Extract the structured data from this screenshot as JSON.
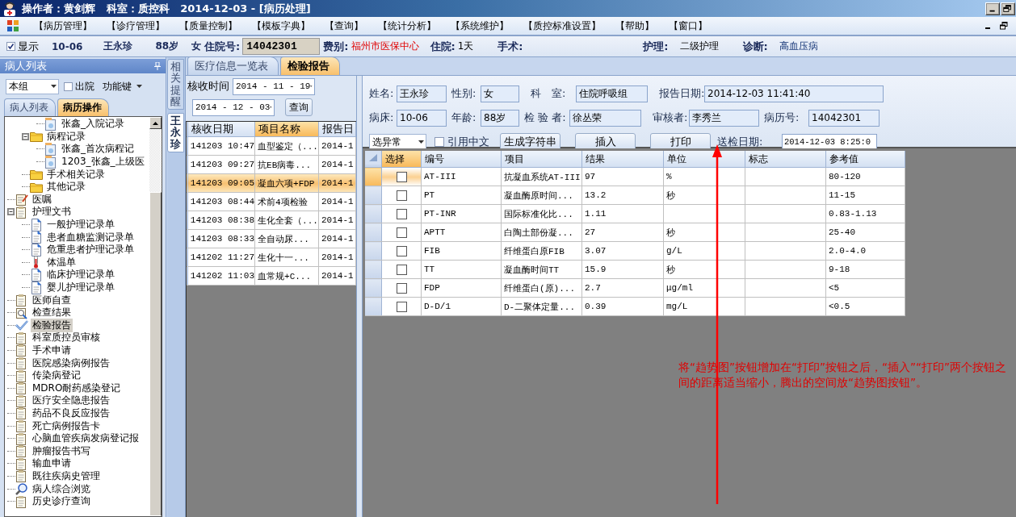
{
  "window": {
    "title": "操作者：黄剑辉   科室：质控科   2014-12-03 - [病历处理]"
  },
  "menu": [
    "【病历管理】",
    "【诊疗管理】",
    "【质量控制】",
    "【模板字典】",
    "【查询】",
    "【统计分析】",
    "【系统维护】",
    "【质控标准设置】",
    "【帮助】",
    "【窗口】"
  ],
  "patient_bar": {
    "show": {
      "label": "显示",
      "checked": true
    },
    "bed": "10-06",
    "name": "王永珍",
    "age": "88岁",
    "sex": "女",
    "fields": [
      {
        "label": "住院号:",
        "value": "14042301",
        "kind": "box"
      },
      {
        "label": "费别:",
        "value": "福州市医保中心",
        "kind": "alert"
      },
      {
        "label": "住院:",
        "value": "1天",
        "kind": "plain"
      },
      {
        "label": "手术:"
      },
      {
        "label": "护理:",
        "value": "二级护理",
        "kind": "plain"
      },
      {
        "label": "诊断:",
        "value": "高血压病",
        "kind": "info"
      }
    ]
  },
  "patient_panel": {
    "title": "病人列表",
    "group_select": "本组",
    "discharged": {
      "label": "出院",
      "checked": false
    },
    "function_menu": "功能键",
    "tabs": [
      {
        "label": "病人列表",
        "selected": false
      },
      {
        "label": "病历操作",
        "selected": true
      }
    ],
    "tree": [
      {
        "children": [
          {
            "children": [
              {
                "label": "张鑫_入院记录",
                "kind": "record",
                "selected": false
              }
            ]
          },
          {
            "label": "病程记录",
            "kind": "folder",
            "expanded": true,
            "selected": false,
            "children": [
              {
                "label": "张鑫_首次病程记",
                "kind": "record",
                "selected": false
              },
              {
                "label": "1203_张鑫_上级医",
                "kind": "record",
                "selected": false
              }
            ]
          },
          {
            "label": "手术相关记录",
            "kind": "folder",
            "selected": false
          },
          {
            "label": "其他记录",
            "kind": "folder",
            "selected": false
          }
        ]
      },
      {
        "label": "医嘱",
        "kind": "note",
        "selected": false
      },
      {
        "label": "护理文书",
        "kind": "clipboard",
        "expanded": true,
        "selected": false,
        "children": [
          {
            "label": "一般护理记录单",
            "kind": "page",
            "selected": false
          },
          {
            "label": "患者血糖监测记录单",
            "kind": "page",
            "selected": false
          },
          {
            "label": "危重患者护理记录单",
            "kind": "page",
            "selected": false
          },
          {
            "label": "体温单",
            "kind": "thermometer",
            "selected": false
          },
          {
            "label": "临床护理记录单",
            "kind": "page",
            "selected": false
          },
          {
            "label": "婴儿护理记录单",
            "kind": "page",
            "selected": false
          }
        ]
      },
      {
        "label": "医师自查",
        "kind": "clipboard",
        "selected": false
      },
      {
        "label": "检查结果",
        "kind": "finder",
        "selected": false
      },
      {
        "label": "检验报告",
        "kind": "check",
        "selected": true
      },
      {
        "label": "科室质控员审核",
        "kind": "clipboard",
        "selected": false
      },
      {
        "label": "手术申请",
        "kind": "clipboard",
        "selected": false
      },
      {
        "label": "医院感染病例报告",
        "kind": "clipboard",
        "selected": false
      },
      {
        "label": "传染病登记",
        "kind": "clipboard",
        "selected": false
      },
      {
        "label": "MDRO耐药感染登记",
        "kind": "clipboard",
        "selected": false
      },
      {
        "label": "医疗安全隐患报告",
        "kind": "clipboard",
        "selected": false
      },
      {
        "label": "药品不良反应报告",
        "kind": "clipboard",
        "selected": false
      },
      {
        "label": "死亡病例报告卡",
        "kind": "clipboard",
        "selected": false
      },
      {
        "label": "心脑血管疾病发病登记报",
        "kind": "clipboard",
        "selected": false
      },
      {
        "label": "肿瘤报告书写",
        "kind": "clipboard",
        "selected": false
      },
      {
        "label": "输血申请",
        "kind": "clipboard",
        "selected": false
      },
      {
        "label": "既往疾病史管理",
        "kind": "clipboard",
        "selected": false
      },
      {
        "label": "病人综合浏览",
        "kind": "lens",
        "selected": false
      },
      {
        "label": "历史诊疗查询",
        "kind": "clipboard",
        "selected": false
      }
    ]
  },
  "side_tabs": [
    {
      "label": "相关提醒",
      "selected": false
    },
    {
      "label": "王永珍",
      "selected": true
    }
  ],
  "main_tabs": [
    {
      "label": "医疗信息一览表",
      "selected": false
    },
    {
      "label": "检验报告",
      "selected": true
    }
  ],
  "lab_list": {
    "receive_time_label": "核收时间",
    "date_from": "2014 - 11 - 19",
    "date_to": "2014 - 12 - 03",
    "query_button": "查询",
    "columns": [
      {
        "label": "核收日期",
        "highlighted": false
      },
      {
        "label": "项目名称",
        "highlighted": true
      },
      {
        "label": "报告日",
        "highlighted": false
      }
    ],
    "rows": [
      {
        "selected": false,
        "cells": [
          "141203 10:47",
          "血型鉴定（...",
          "2014-1"
        ]
      },
      {
        "selected": false,
        "cells": [
          "141203 09:27",
          "抗EB病毒...",
          "2014-1"
        ]
      },
      {
        "selected": true,
        "cells": [
          "141203 09:05",
          "凝血六项+FDP",
          "2014-1"
        ]
      },
      {
        "selected": false,
        "cells": [
          "141203 08:44",
          "术前4项检验",
          "2014-1"
        ]
      },
      {
        "selected": false,
        "cells": [
          "141203 08:38",
          "生化全套（...",
          "2014-1"
        ]
      },
      {
        "selected": false,
        "cells": [
          "141203 08:33",
          "全自动尿...",
          "2014-1"
        ]
      },
      {
        "selected": false,
        "cells": [
          "141202 11:27",
          "生化十一...",
          "2014-1"
        ]
      },
      {
        "selected": false,
        "cells": [
          "141202 11:03",
          "血常规+C...",
          "2014-1"
        ]
      }
    ]
  },
  "report": {
    "form_rows": [
      [
        {
          "label": "姓名:",
          "value": "王永珍"
        },
        {
          "label": "性别:",
          "value": "女"
        },
        {
          "label": "科　室:",
          "value": "住院呼吸组"
        },
        {
          "label": "报告日期:",
          "value": "2014-12-03 11:41:40"
        }
      ],
      [
        {
          "label": "病床:",
          "value": "10-06"
        },
        {
          "label": "年龄:",
          "value": "88岁"
        },
        {
          "label": "检 验 者:",
          "value": "徐丛荣"
        },
        {
          "label": "审核者:",
          "value": "李秀兰"
        },
        {
          "label": "病历号:",
          "value": "14042301"
        }
      ]
    ],
    "abnormal_select": "选异常",
    "use_chinese": {
      "label": "引用中文",
      "checked": false
    },
    "buttons": [
      "生成字符串",
      "插入",
      "打印"
    ],
    "send_date": {
      "label": "送检日期:",
      "value": "2014-12-03 8:25:0"
    },
    "columns": [
      {
        "label": "选择",
        "highlighted": true
      },
      {
        "label": "编号",
        "highlighted": false
      },
      {
        "label": "项目",
        "highlighted": false
      },
      {
        "label": "结果",
        "highlighted": false
      },
      {
        "label": "单位",
        "highlighted": false
      },
      {
        "label": "标志",
        "highlighted": false
      },
      {
        "label": "参考值",
        "highlighted": false
      }
    ],
    "rows": [
      {
        "selected": true,
        "checked": false,
        "code": "AT-III",
        "item": "抗凝血系统AT-III",
        "result": "97",
        "unit": "%",
        "reference": "80-120"
      },
      {
        "selected": false,
        "checked": false,
        "code": "PT",
        "item": "凝血酶原时间...",
        "result": "13.2",
        "unit": "秒",
        "reference": "11-15"
      },
      {
        "selected": false,
        "checked": false,
        "code": "PT-INR",
        "item": "国际标准化比...",
        "result": "1.11",
        "reference": "0.83-1.13"
      },
      {
        "selected": false,
        "checked": false,
        "code": "APTT",
        "item": "白陶土部份凝...",
        "result": "27",
        "unit": "秒",
        "reference": "25-40"
      },
      {
        "selected": false,
        "checked": false,
        "code": "FIB",
        "item": "纤维蛋白原FIB",
        "result": "3.07",
        "unit": "g/L",
        "reference": "2.0-4.0"
      },
      {
        "selected": false,
        "checked": false,
        "code": "TT",
        "item": "凝血酶时间TT",
        "result": "15.9",
        "unit": "秒",
        "reference": "9-18"
      },
      {
        "selected": false,
        "checked": false,
        "code": "FDP",
        "item": "纤维蛋白(原)...",
        "result": "2.7",
        "unit": "μg/ml",
        "reference": "<5"
      },
      {
        "selected": false,
        "checked": false,
        "code": "D-D/1",
        "item": "D-二聚体定量...",
        "result": "0.39",
        "unit": "mg/L",
        "reference": "<0.5"
      }
    ]
  },
  "annotation": {
    "text": "将“趋势图”按钮增加在“打印”按钮之后，“插入”“打印”两个按钮之间的距离适当缩小，腾出的空间放“趋势图按钮”。"
  }
}
